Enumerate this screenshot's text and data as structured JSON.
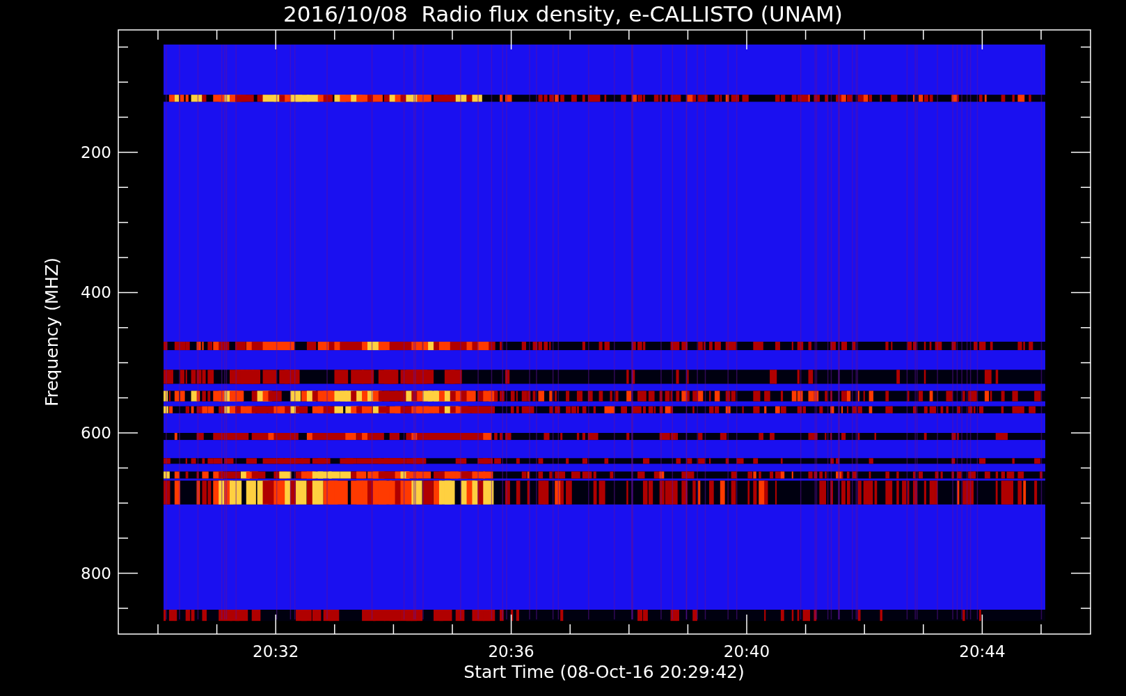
{
  "plot": {
    "title": "2016/10/08  Radio flux density, e-CALLISTO (UNAM)",
    "ylabel": "Frequency (MHZ)",
    "xlabel": "Start Time (08-Oct-16 20:29:42)",
    "y_tick_labels": [
      "200",
      "400",
      "600",
      "800"
    ],
    "x_tick_labels": [
      "20:32",
      "20:36",
      "20:40",
      "20:44"
    ]
  }
}
